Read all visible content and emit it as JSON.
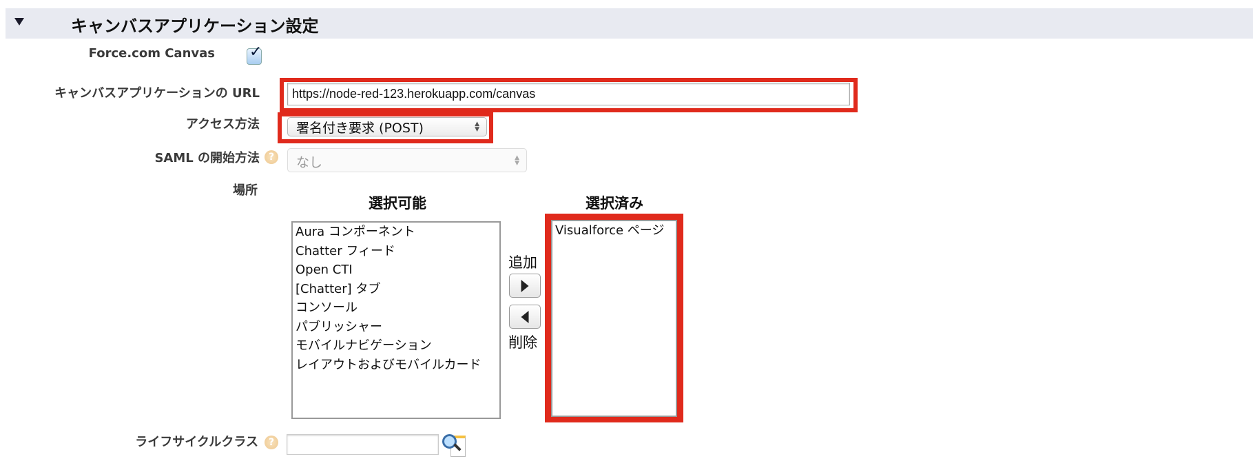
{
  "section": {
    "title": "キャンバスアプリケーション設定",
    "collapse_icon": "triangle-down-icon",
    "header_bg": "#e8eaf1"
  },
  "fields": {
    "canvas": {
      "label": "Force.com Canvas",
      "checked": true
    },
    "url": {
      "label": "キャンバスアプリケーションの URL",
      "value": "https://node-red-123.herokuapp.com/canvas"
    },
    "access": {
      "label": "アクセス方法",
      "value": "署名付き要求 (POST)"
    },
    "saml": {
      "label": "SAML の開始方法",
      "value": "なし",
      "disabled": true,
      "help_icon": "?"
    },
    "location": {
      "label": "場所",
      "available_header": "選択可能",
      "selected_header": "選択済み",
      "available": [
        "Aura コンポーネント",
        "Chatter フィード",
        "Open CTI",
        "[Chatter] タブ",
        "コンソール",
        "パブリッシャー",
        "モバイルナビゲーション",
        "レイアウトおよびモバイルカード"
      ],
      "selected": [
        "Visualforce ページ"
      ],
      "add_label": "追加",
      "remove_label": "削除"
    },
    "lifecycle": {
      "label": "ライフサイクルクラス",
      "value": "",
      "help_icon": "?"
    }
  },
  "highlight_color": "#e02a1c"
}
